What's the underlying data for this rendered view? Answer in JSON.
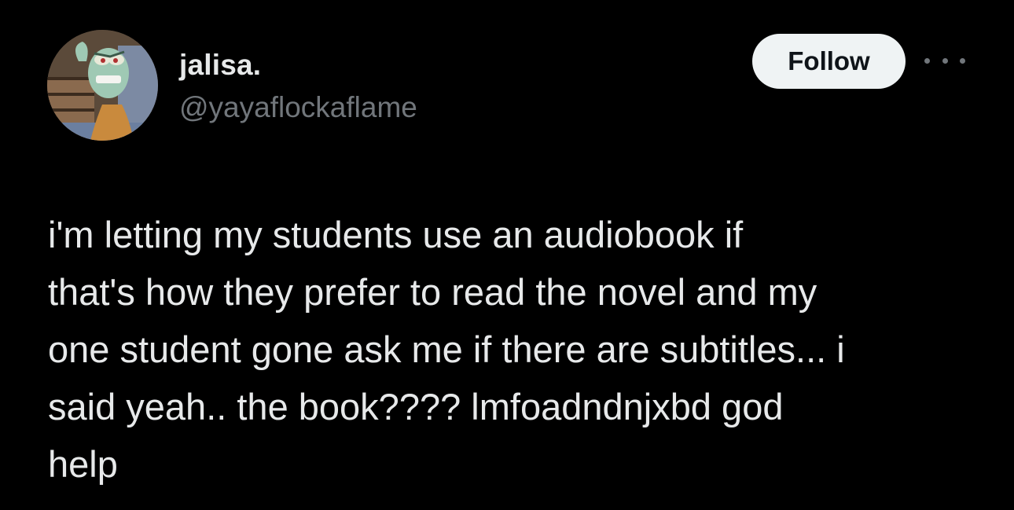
{
  "author": {
    "display_name": "jalisa.",
    "handle": "@yayaflockaflame"
  },
  "actions": {
    "follow_label": "Follow",
    "more_icon": "more-horizontal-icon"
  },
  "tweet": {
    "text": "i'm letting my students use an audiobook if\nthat's how they prefer to read the novel and my\none student gone ask me if there are subtitles... i\nsaid yeah.. the book???? lmfoadndnjxbd god\nhelp"
  },
  "colors": {
    "background": "#000000",
    "primary_text": "#e7e9ea",
    "secondary_text": "#71767b",
    "follow_button_bg": "#eff3f4",
    "follow_button_text": "#0f1419"
  }
}
